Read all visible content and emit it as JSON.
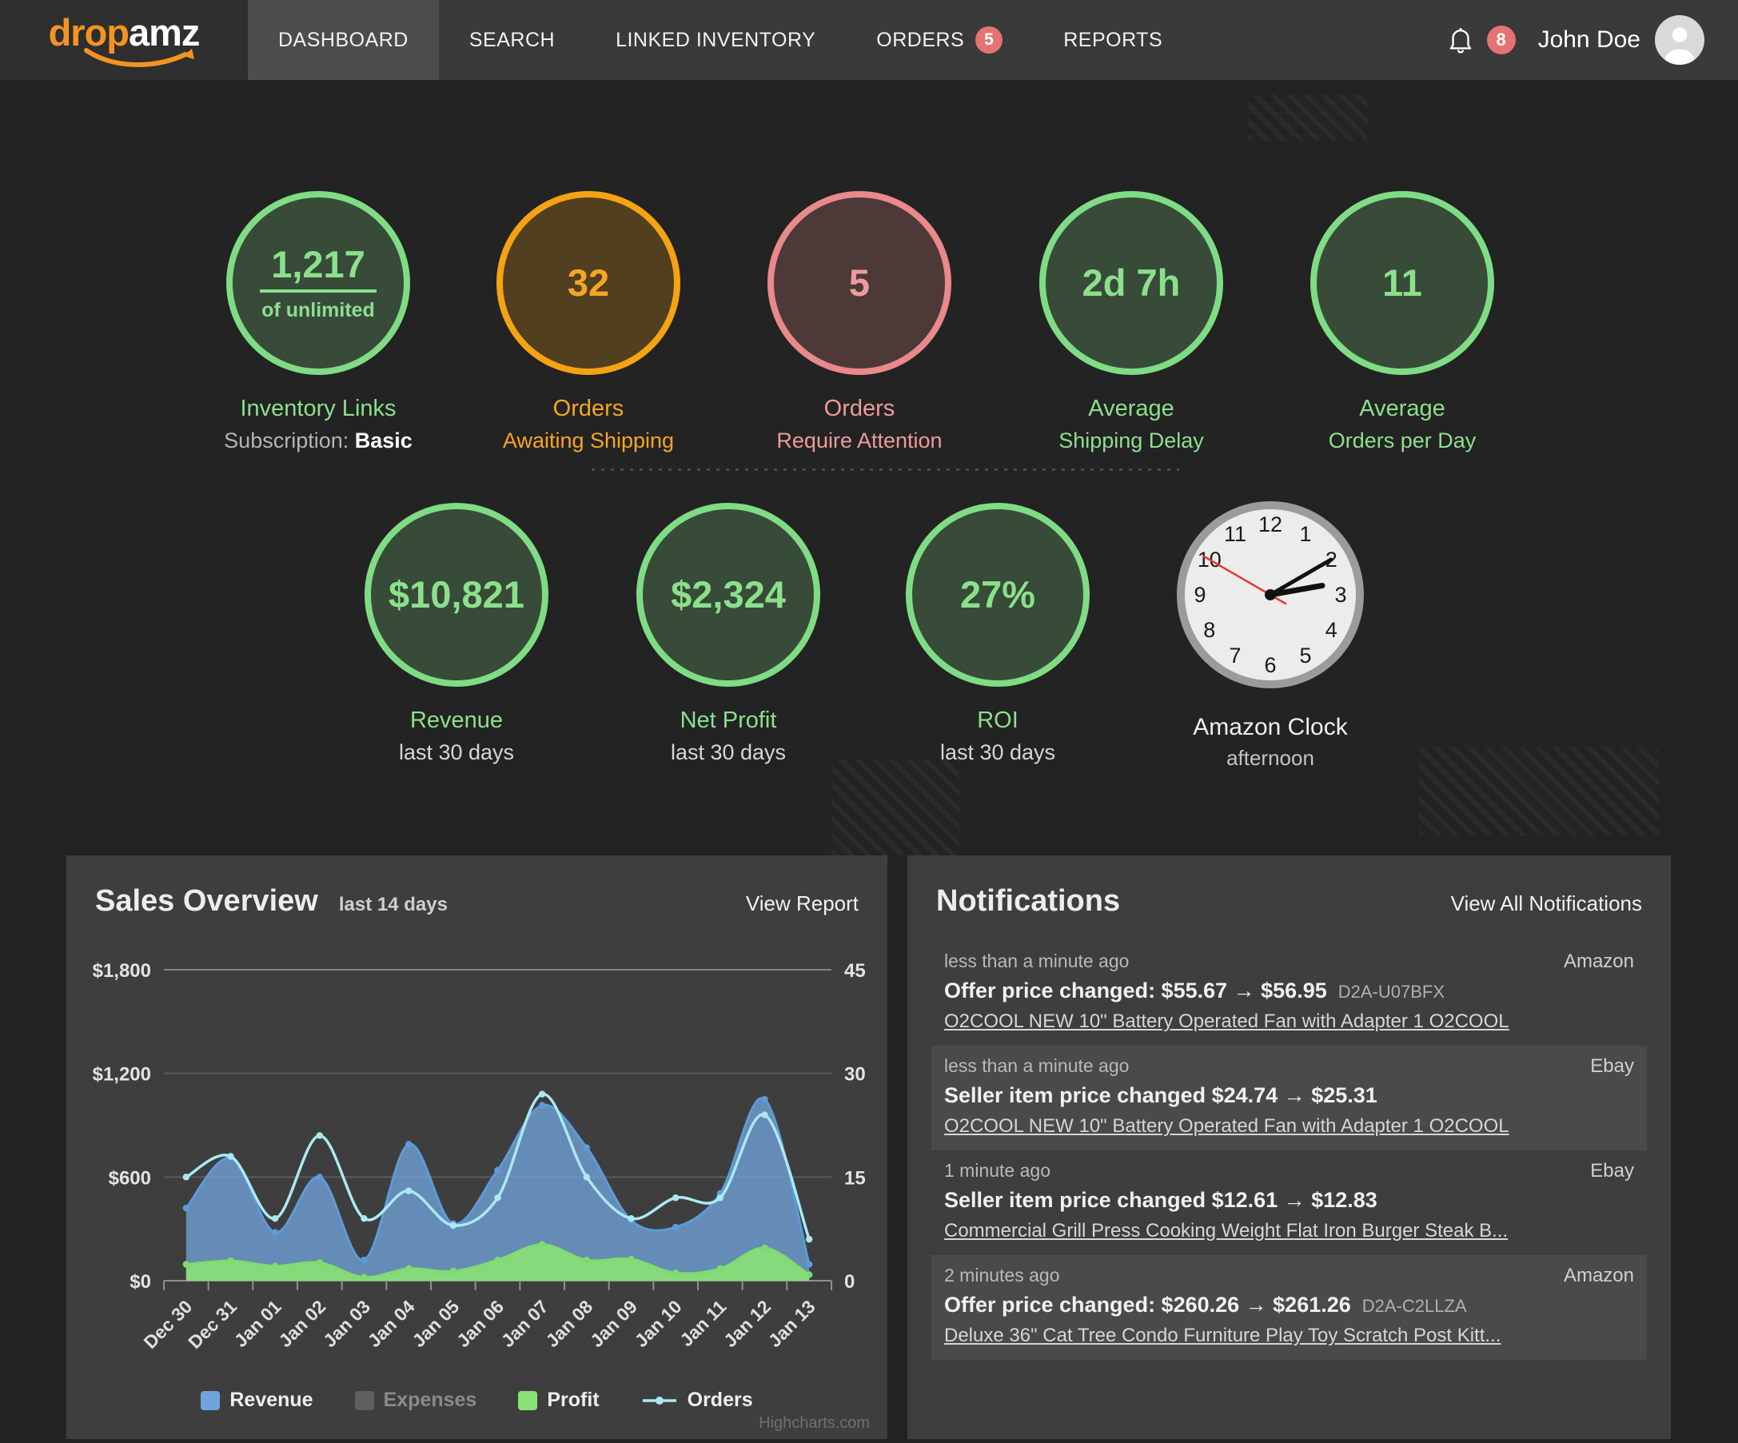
{
  "nav": {
    "logo": {
      "part1": "drop",
      "part2": "amz"
    },
    "items": [
      {
        "label": "DASHBOARD",
        "active": true
      },
      {
        "label": "SEARCH"
      },
      {
        "label": "LINKED INVENTORY"
      },
      {
        "label": "ORDERS",
        "badge": "5"
      },
      {
        "label": "REPORTS"
      }
    ],
    "notifications_count": "8",
    "user_name": "John Doe"
  },
  "stats_row1": [
    {
      "value": "1,217",
      "underline": true,
      "sub_value": "of unlimited",
      "color": "green",
      "label_line1": "Inventory Links",
      "label_line2_prefix": "Subscription: ",
      "label_line2_bold": "Basic"
    },
    {
      "value": "32",
      "color": "orange",
      "label_line1": "Orders",
      "label_line2": "Awaiting Shipping"
    },
    {
      "value": "5",
      "color": "red",
      "label_line1": "Orders",
      "label_line2": "Require Attention"
    },
    {
      "value": "2d 7h",
      "color": "green",
      "label_line1": "Average",
      "label_line2": "Shipping Delay"
    },
    {
      "value": "11",
      "color": "green",
      "label_line1": "Average",
      "label_line2": "Orders per Day"
    }
  ],
  "stats_row2": [
    {
      "value": "$10,821",
      "color": "green",
      "label_line1": "Revenue",
      "label_line2": "last 30 days",
      "l2_muted": true
    },
    {
      "value": "$2,324",
      "color": "green",
      "label_line1": "Net Profit",
      "label_line2": "last 30 days",
      "l2_muted": true
    },
    {
      "value": "27%",
      "color": "green",
      "label_line1": "ROI",
      "label_line2": "last 30 days",
      "l2_muted": true
    }
  ],
  "clock": {
    "label_line1": "Amazon Clock",
    "label_line2": "afternoon",
    "numbers": [
      "1",
      "2",
      "3",
      "4",
      "5",
      "6",
      "7",
      "8",
      "9",
      "10",
      "11",
      "12"
    ]
  },
  "sales_panel": {
    "title": "Sales Overview",
    "subtitle": "last 14 days",
    "action": "View Report",
    "credit": "Highcharts.com"
  },
  "chart_data": {
    "type": "area",
    "title": "Sales Overview",
    "categories": [
      "Dec 30",
      "Dec 31",
      "Jan 01",
      "Jan 02",
      "Jan 03",
      "Jan 04",
      "Jan 05",
      "Jan 06",
      "Jan 07",
      "Jan 08",
      "Jan 09",
      "Jan 10",
      "Jan 11",
      "Jan 12",
      "Jan 13"
    ],
    "series": [
      {
        "name": "Revenue",
        "type": "area",
        "axis": "left",
        "color": "#6fa3da",
        "line_color": "#5d9bd9",
        "values": [
          420,
          710,
          280,
          600,
          120,
          790,
          330,
          640,
          1015,
          770,
          350,
          310,
          505,
          1050,
          95
        ]
      },
      {
        "name": "Expenses",
        "type": "area",
        "axis": "left",
        "color": "#5f5f5f",
        "disabled": true,
        "values": []
      },
      {
        "name": "Profit",
        "type": "area",
        "axis": "left",
        "color": "#8ae276",
        "line_color": "#7edc6a",
        "values": [
          95,
          115,
          85,
          105,
          20,
          70,
          55,
          120,
          210,
          120,
          125,
          45,
          70,
          190,
          35
        ]
      },
      {
        "name": "Orders",
        "type": "line",
        "axis": "right",
        "color": "#abe9f2",
        "line_color": "#abe9f2",
        "values": [
          15,
          18,
          9,
          21,
          9,
          13,
          8,
          12,
          27,
          15,
          9,
          12,
          12,
          24,
          6
        ]
      }
    ],
    "left_axis": {
      "labels": [
        "$1,800",
        "$1,200",
        "$600",
        "$0"
      ],
      "values": [
        1800,
        1200,
        600,
        0
      ],
      "min": 0,
      "max": 1800
    },
    "right_axis": {
      "labels": [
        "45",
        "30",
        "15",
        "0"
      ],
      "values": [
        45,
        30,
        15,
        0
      ],
      "min": 0,
      "max": 45
    },
    "grid": true,
    "legend_position": "bottom"
  },
  "notifications_panel": {
    "title": "Notifications",
    "action": "View All Notifications",
    "items": [
      {
        "time": "less than a minute ago",
        "source": "Amazon",
        "main": "Offer price changed: $55.67 → $56.95",
        "sku": "D2A-U07BFX",
        "link": "O2COOL NEW 10\" Battery Operated Fan with Adapter 1 O2COOL",
        "highlighted": false
      },
      {
        "time": "less than a minute ago",
        "source": "Ebay",
        "main": "Seller item price changed $24.74 → $25.31",
        "sku": "",
        "link": "O2COOL NEW 10\" Battery Operated Fan with Adapter 1 O2COOL",
        "highlighted": true
      },
      {
        "time": "1 minute ago",
        "source": "Ebay",
        "main": "Seller item price changed $12.61 → $12.83",
        "sku": "",
        "link": "Commercial Grill Press Cooking Weight Flat Iron Burger Steak B...",
        "highlighted": false
      },
      {
        "time": "2 minutes ago",
        "source": "Amazon",
        "main": "Offer price changed: $260.26 → $261.26",
        "sku": "D2A-C2LLZA",
        "link": "Deluxe 36\" Cat Tree Condo Furniture Play Toy Scratch Post Kitt...",
        "highlighted": true
      }
    ]
  }
}
